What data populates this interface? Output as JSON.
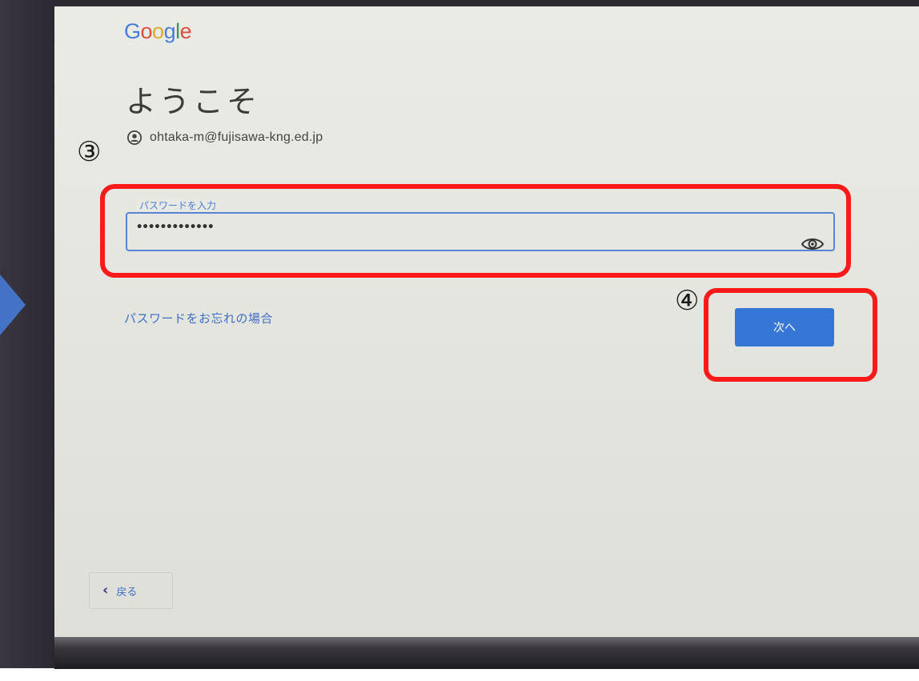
{
  "logo": {
    "letters": [
      "G",
      "o",
      "o",
      "g",
      "l",
      "e"
    ]
  },
  "signin": {
    "title": "ようこそ",
    "account_email": "ohtaka-m@fujisawa-kng.ed.jp",
    "password_label": "パスワードを入力",
    "password_value": "•••••••••••••",
    "forgot_link": "パスワードをお忘れの場合",
    "next_button": "次へ",
    "back_button": "戻る"
  },
  "annotations": {
    "step_3": "③",
    "step_4": "④"
  },
  "colors": {
    "highlight": "#ff1a1a",
    "primary_button": "#3576d6",
    "arrow": "#4472c4"
  },
  "icons": {
    "account": "account-circle-icon",
    "password_toggle": "eye-icon",
    "back": "chevron-left-icon"
  }
}
